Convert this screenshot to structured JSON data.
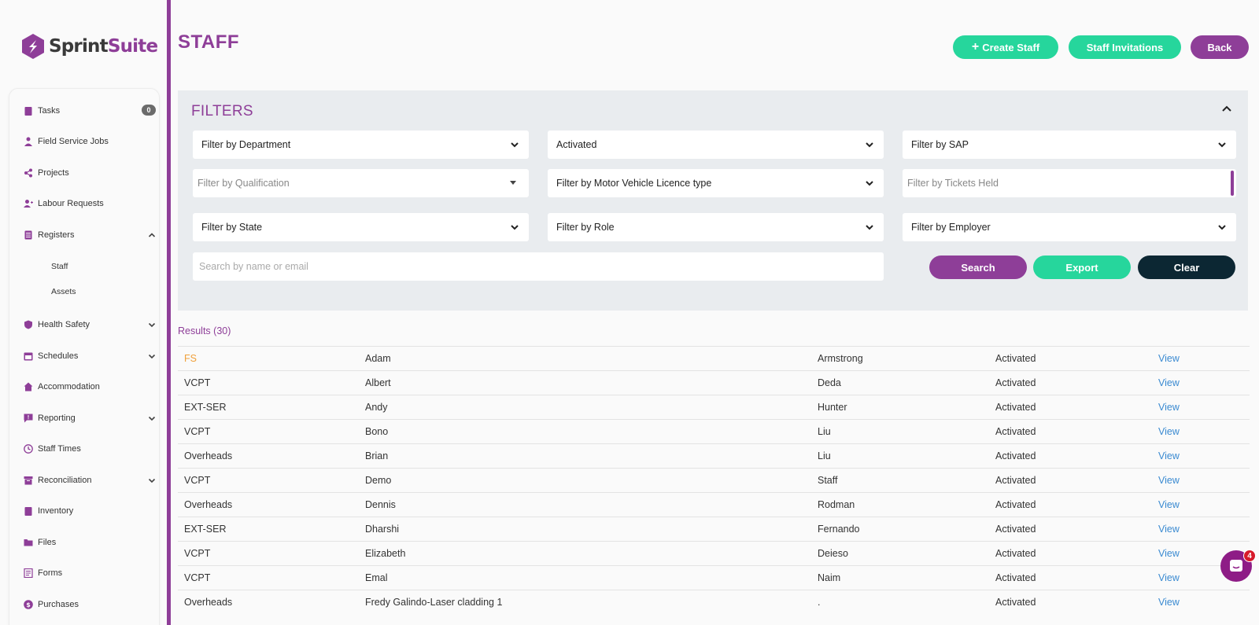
{
  "app": {
    "logo_text_a": "Sprint",
    "logo_text_b": "Suite"
  },
  "colors": {
    "brand_purple": "#8e3e98",
    "accent_green": "#26d69c",
    "dark": "#0c2733",
    "link_blue": "#3a8ad1",
    "highlight_orange": "#f0a03a"
  },
  "sidebar": {
    "tasks_label": "Tasks",
    "tasks_badge": "0",
    "field_service_jobs": "Field Service Jobs",
    "projects": "Projects",
    "labour_requests": "Labour Requests",
    "registers": "Registers",
    "registers_staff": "Staff",
    "registers_assets": "Assets",
    "health_safety": "Health Safety",
    "schedules": "Schedules",
    "accommodation": "Accommodation",
    "reporting": "Reporting",
    "staff_times": "Staff Times",
    "reconciliation": "Reconciliation",
    "inventory": "Inventory",
    "files": "Files",
    "forms": "Forms",
    "purchases": "Purchases"
  },
  "header": {
    "title": "STAFF",
    "create_staff": "Create Staff",
    "staff_invitations": "Staff Invitations",
    "back": "Back"
  },
  "filters": {
    "title": "FILTERS",
    "department": "Filter by Department",
    "status": "Activated",
    "sap": "Filter by SAP",
    "qualification": "Filter by Qualification",
    "licence": "Filter by Motor Vehicle Licence type",
    "tickets_placeholder": "Filter by Tickets Held",
    "state": "Filter by State",
    "role": "Filter by Role",
    "employer": "Filter by Employer",
    "search_placeholder": "Search by name or email",
    "search_button": "Search",
    "export_button": "Export",
    "clear_button": "Clear"
  },
  "results": {
    "count_label": "Results (30)",
    "rows": [
      {
        "dept": "FS",
        "first": "Adam",
        "last": "Armstrong",
        "status": "Activated",
        "action": "View"
      },
      {
        "dept": "VCPT",
        "first": "Albert",
        "last": "Deda",
        "status": "Activated",
        "action": "View"
      },
      {
        "dept": "EXT-SER",
        "first": "Andy",
        "last": "Hunter",
        "status": "Activated",
        "action": "View"
      },
      {
        "dept": "VCPT",
        "first": "Bono",
        "last": "Liu",
        "status": "Activated",
        "action": "View"
      },
      {
        "dept": "Overheads",
        "first": "Brian",
        "last": "Liu",
        "status": "Activated",
        "action": "View"
      },
      {
        "dept": "VCPT",
        "first": "Demo",
        "last": "Staff",
        "status": "Activated",
        "action": "View"
      },
      {
        "dept": "Overheads",
        "first": "Dennis",
        "last": "Rodman",
        "status": "Activated",
        "action": "View"
      },
      {
        "dept": "EXT-SER",
        "first": "Dharshi",
        "last": "Fernando",
        "status": "Activated",
        "action": "View"
      },
      {
        "dept": "VCPT",
        "first": "Elizabeth",
        "last": "Deieso",
        "status": "Activated",
        "action": "View"
      },
      {
        "dept": "VCPT",
        "first": "Emal",
        "last": "Naim",
        "status": "Activated",
        "action": "View"
      },
      {
        "dept": "Overheads",
        "first": "Fredy Galindo-Laser cladding 1",
        "last": ".",
        "status": "Activated",
        "action": "View"
      }
    ]
  },
  "chat": {
    "badge": "4"
  }
}
